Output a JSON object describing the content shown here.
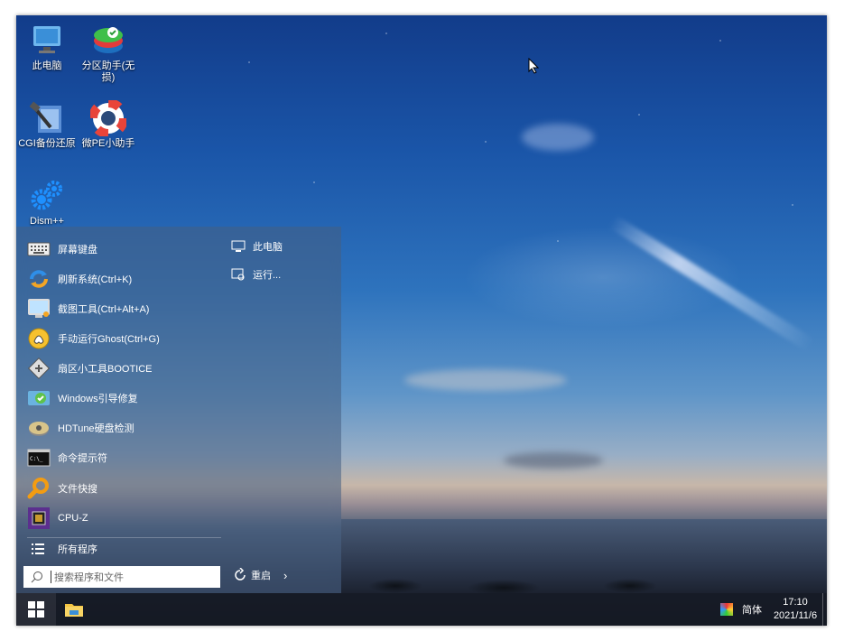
{
  "desktop": {
    "icons": [
      {
        "label": "此电脑",
        "icon": "monitor-icon"
      },
      {
        "label": "分区助手(无损)",
        "icon": "partition-assistant-icon"
      },
      {
        "label": "CGI备份还原",
        "icon": "cgi-backup-icon"
      },
      {
        "label": "微PE小助手",
        "icon": "lifebuoy-icon"
      },
      {
        "label": "Dism++",
        "icon": "gears-icon"
      }
    ]
  },
  "start_menu": {
    "apps": [
      {
        "label": "屏幕键盘",
        "icon": "keyboard-icon"
      },
      {
        "label": "刷新系统(Ctrl+K)",
        "icon": "refresh-icon"
      },
      {
        "label": "截图工具(Ctrl+Alt+A)",
        "icon": "screenshot-icon"
      },
      {
        "label": "手动运行Ghost(Ctrl+G)",
        "icon": "ghost-icon"
      },
      {
        "label": "扇区小工具BOOTICE",
        "icon": "bootice-icon"
      },
      {
        "label": "Windows引导修复",
        "icon": "boot-repair-icon"
      },
      {
        "label": "HDTune硬盘检测",
        "icon": "hdd-icon"
      },
      {
        "label": "命令提示符",
        "icon": "cmd-icon"
      },
      {
        "label": "文件快搜",
        "icon": "magnifier-icon"
      },
      {
        "label": "CPU-Z",
        "icon": "cpu-icon"
      }
    ],
    "all_programs": "所有程序",
    "right_items": [
      {
        "label": "此电脑",
        "icon": "computer-icon"
      },
      {
        "label": "运行...",
        "icon": "run-icon"
      }
    ],
    "search_placeholder": "搜索程序和文件",
    "restart_label": "重启"
  },
  "taskbar": {
    "ime_label": "简体",
    "time": "17:10",
    "date": "2021/11/6"
  }
}
